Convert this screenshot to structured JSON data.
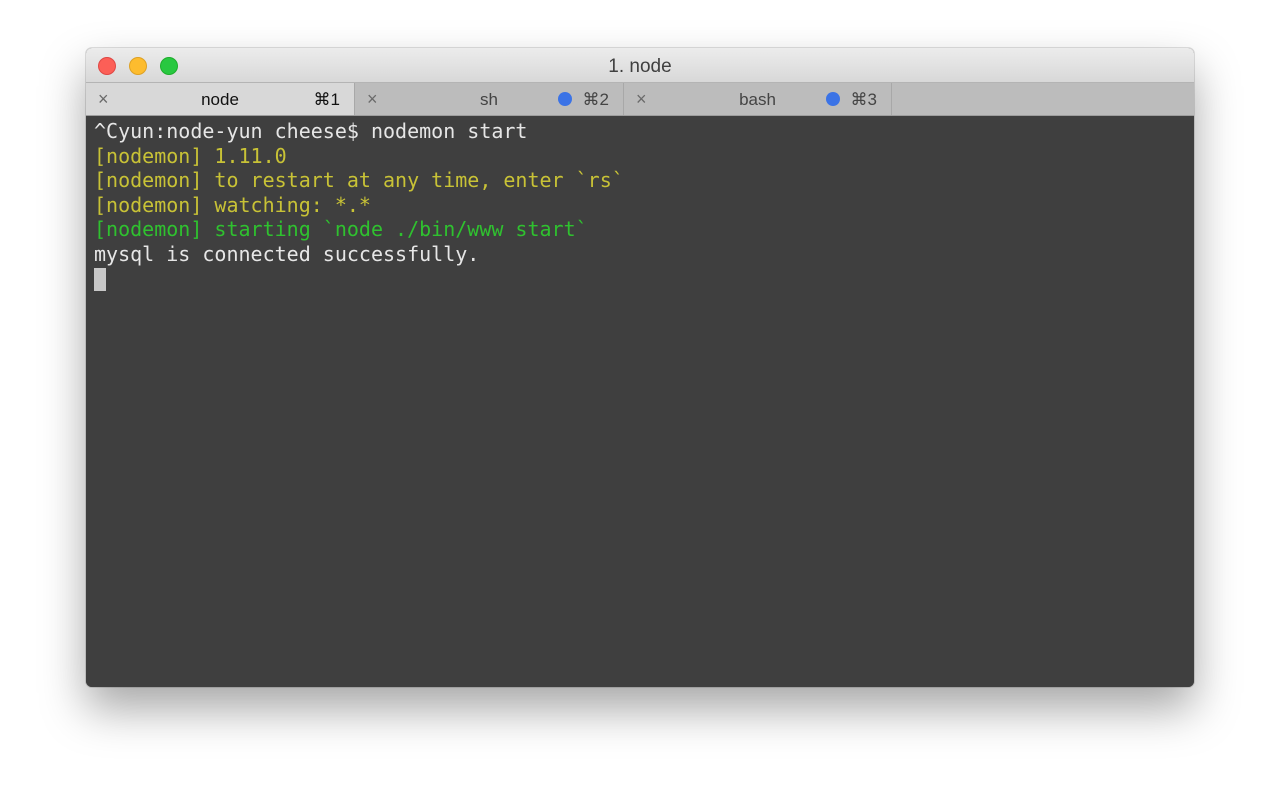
{
  "window": {
    "title": "1. node",
    "traffic_lights": [
      "close",
      "minimize",
      "maximize"
    ]
  },
  "tabs": [
    {
      "name": "node",
      "shortcut": "⌘1",
      "active": true,
      "activity_dot": false,
      "close_icon": "×"
    },
    {
      "name": "sh",
      "shortcut": "⌘2",
      "active": false,
      "activity_dot": true,
      "close_icon": "×"
    },
    {
      "name": "bash",
      "shortcut": "⌘3",
      "active": false,
      "activity_dot": true,
      "close_icon": "×"
    }
  ],
  "terminal": {
    "lines": [
      {
        "text": "^Cyun:node-yun cheese$ nodemon start",
        "color": "#e6e6e6"
      },
      {
        "text": "[nodemon] 1.11.0",
        "color": "#c8c236"
      },
      {
        "text": "[nodemon] to restart at any time, enter `rs`",
        "color": "#c8c236"
      },
      {
        "text": "[nodemon] watching: *.*",
        "color": "#c8c236"
      },
      {
        "text": "[nodemon] starting `node ./bin/www start`",
        "color": "#2fc12f"
      },
      {
        "text": "mysql is connected successfully.",
        "color": "#e6e6e6"
      }
    ]
  },
  "colors": {
    "terminal_bg": "#3f3f3f",
    "activity_dot": "#3b73e6"
  }
}
